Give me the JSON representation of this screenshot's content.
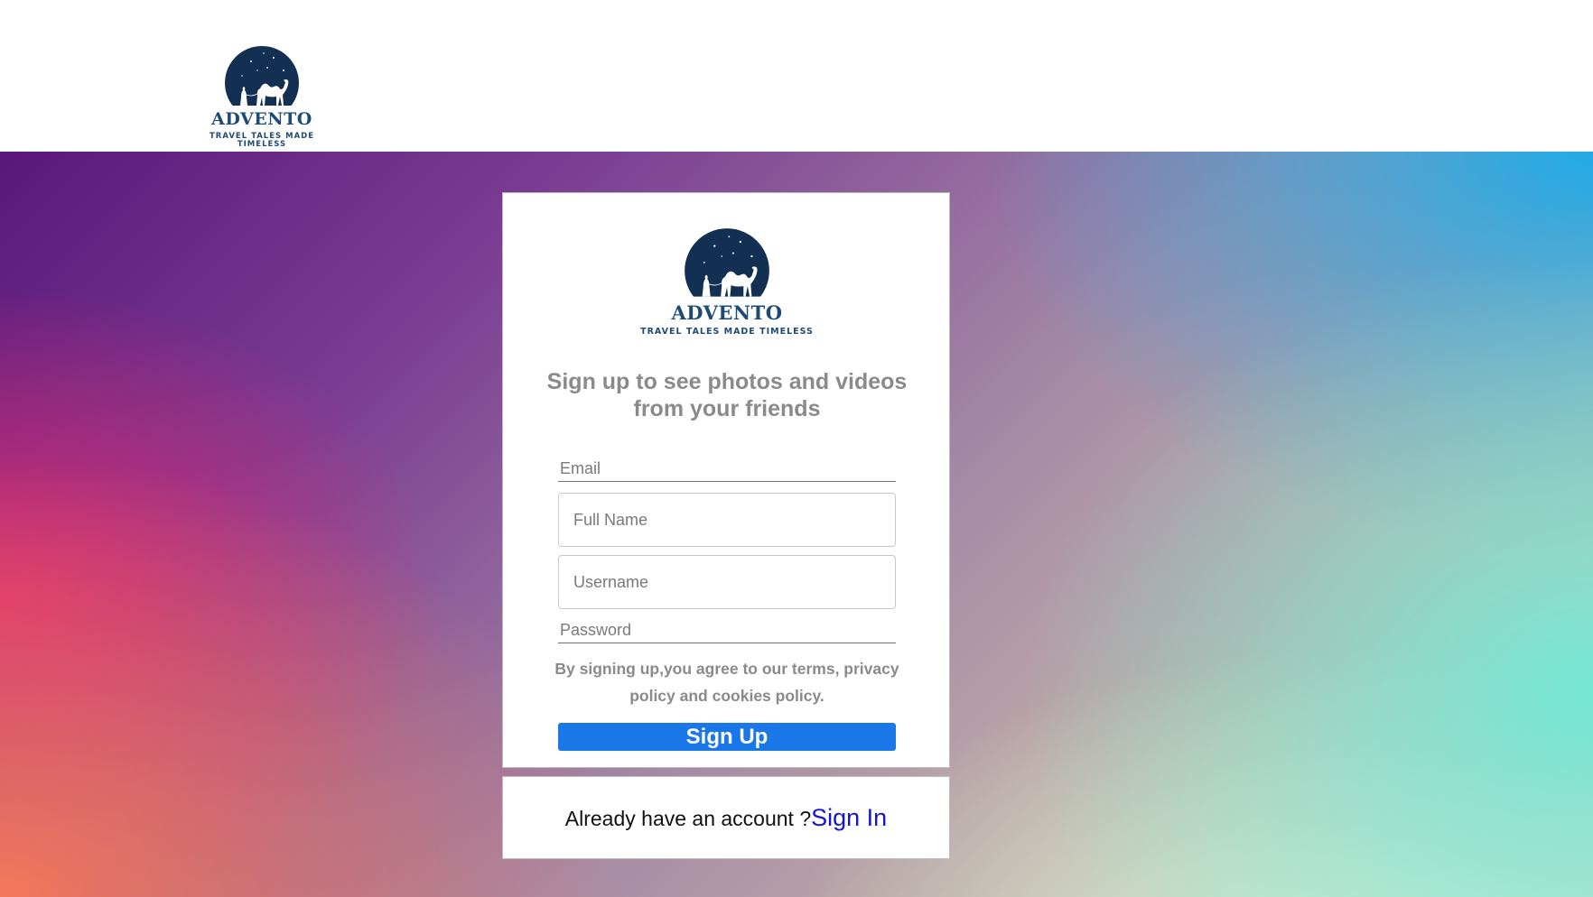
{
  "header": {
    "logo": {
      "brand": "ADVENTO",
      "tagline": "TRAVEL TALES MADE TIMELESS",
      "icon": "camel-moon-icon"
    }
  },
  "signup_card": {
    "logo": {
      "brand": "ADVENTO",
      "tagline": "TRAVEL TALES MADE TIMELESS",
      "icon": "camel-moon-icon"
    },
    "headline": "Sign up to see photos and videos from your friends",
    "fields": {
      "email": {
        "placeholder": "Email",
        "value": ""
      },
      "full_name": {
        "placeholder": "Full Name",
        "value": ""
      },
      "username": {
        "placeholder": "Username",
        "value": ""
      },
      "password": {
        "placeholder": "Password",
        "value": ""
      }
    },
    "terms": "By signing up,you agree to our terms, privacy policy and cookies policy.",
    "submit_label": "Sign Up"
  },
  "signin_card": {
    "prompt": "Already have an account ?",
    "link_label": "Sign In"
  },
  "colors": {
    "brand": "#1e4b75",
    "button": "#1977e8",
    "link": "#1414d6",
    "muted_text": "#8a8a8a"
  }
}
